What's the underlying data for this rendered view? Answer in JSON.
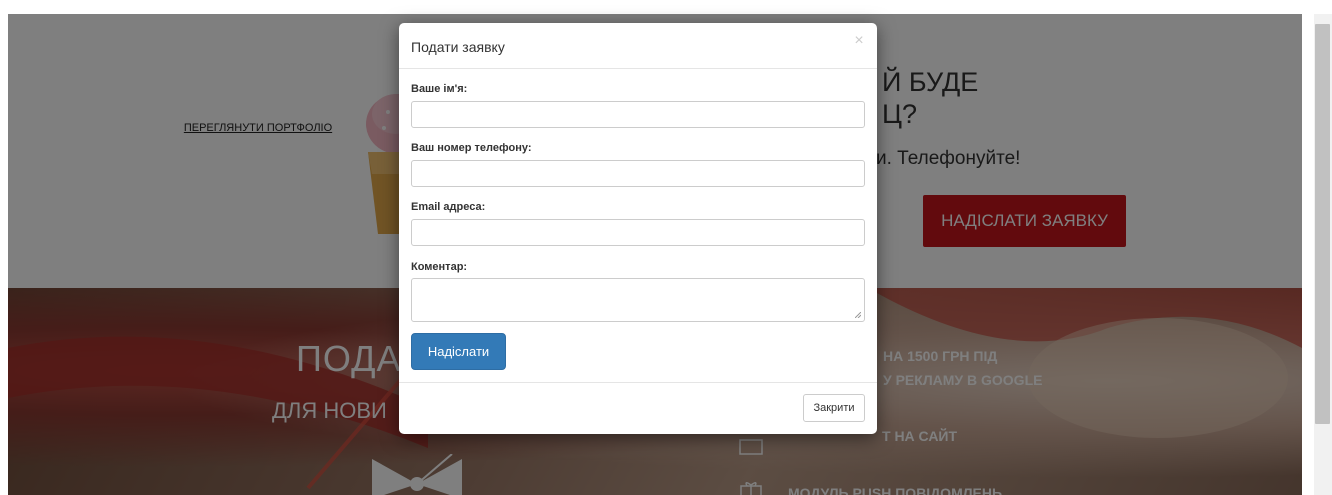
{
  "background": {
    "portfolio_link": "ПЕРЕГЛЯНУТИ ПОРТФОЛІО",
    "headline": "Й БУДЕ\nЦ?",
    "subline": "и. Телефонуйте!",
    "send_request_label": "НАДІСЛАТИ ЗАЯВКУ",
    "promo_title": "ПОДА",
    "promo_sub": "ДЛЯ НОВИ",
    "bonus_1": "НА 1500 ГРН ПІД\nУ РЕКЛАМУ В GOOGLE",
    "bonus_2": "Т НА САЙТ",
    "bonus_3": "МОДУЛЬ PUSH ПОВІДОМЛЕНЬ"
  },
  "modal": {
    "title": "Подати заявку",
    "close_x": "×",
    "fields": [
      {
        "label": "Ваше ім'я:",
        "value": "",
        "placeholder": ""
      },
      {
        "label": "Ваш номер телефону:",
        "value": "",
        "placeholder": ""
      },
      {
        "label": "Email адреса:",
        "value": "",
        "placeholder": ""
      },
      {
        "label": "Коментар:",
        "value": "",
        "placeholder": ""
      }
    ],
    "submit_label": "Надіслати",
    "close_label": "Закрити"
  },
  "colors": {
    "primary_button": "#337ab7",
    "accent_red": "#c4141b",
    "overlay": "rgba(0,0,0,0.5)"
  },
  "icons": [
    "close-icon",
    "gift-icon",
    "chat-icon",
    "bow-icon",
    "cupcake-image",
    "resize-grip-icon"
  ]
}
